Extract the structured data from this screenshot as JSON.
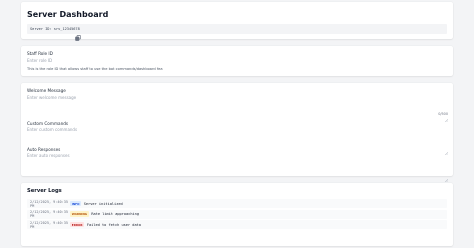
{
  "header": {
    "title": "Server Dashboard",
    "server_id_label": "Server ID: srv_12345678",
    "copy_icon": "copy-icon"
  },
  "staff_role": {
    "label": "Staff Role ID",
    "placeholder": "Enter role ID",
    "help": "This is the role ID that allows staff to use the bot commands/dashboard fea"
  },
  "welcome": {
    "label": "Welcome Message",
    "placeholder": "Enter welcome message",
    "char_count": "0/500"
  },
  "custom_commands": {
    "label": "Custom Commands",
    "placeholder": "Enter custom commands"
  },
  "auto_responses": {
    "label": "Auto Responses",
    "placeholder": "Enter auto responses"
  },
  "logs": {
    "title": "Server Logs",
    "entries": [
      {
        "time": "2/12/2025, 9:40:35 PM",
        "level": "INFO",
        "message": "Server initialized",
        "badge_bg": "#dbeafe",
        "badge_fg": "#1d4ed8"
      },
      {
        "time": "2/12/2025, 9:40:35 PM",
        "level": "WARNING",
        "message": "Rate limit approaching",
        "badge_bg": "#fef3c7",
        "badge_fg": "#b45309"
      },
      {
        "time": "2/12/2025, 9:40:35 PM",
        "level": "ERROR",
        "message": "Failed to fetch user data",
        "badge_bg": "#fee2e2",
        "badge_fg": "#b91c1c"
      }
    ]
  }
}
